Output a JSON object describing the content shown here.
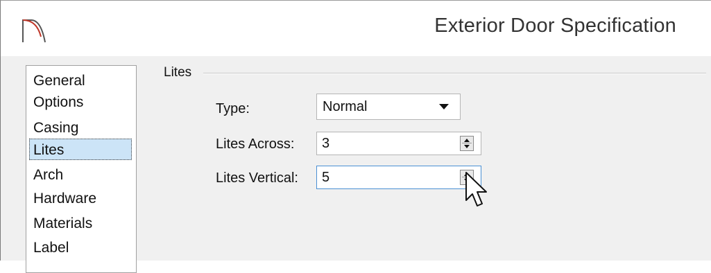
{
  "window": {
    "title": "Exterior Door Specification"
  },
  "nav": {
    "items": [
      {
        "label": "General"
      },
      {
        "label": "Options"
      },
      {
        "label": "Casing"
      },
      {
        "label": "Lites",
        "selected": true
      },
      {
        "label": "Arch"
      },
      {
        "label": "Hardware"
      },
      {
        "label": "Materials"
      },
      {
        "label": "Label"
      }
    ]
  },
  "lites": {
    "group_label": "Lites",
    "type_label": "Type:",
    "type_value": "Normal",
    "across_label": "Lites Across:",
    "across_value": "3",
    "vertical_label": "Lites Vertical:",
    "vertical_value": "5"
  },
  "icons": {
    "app": "door-arch-icon",
    "pointer": "mouse-pointer-icon"
  },
  "colors": {
    "selection": "#cce4f7",
    "focus_border": "#4a8fd4",
    "app_icon_red": "#c0392b"
  }
}
